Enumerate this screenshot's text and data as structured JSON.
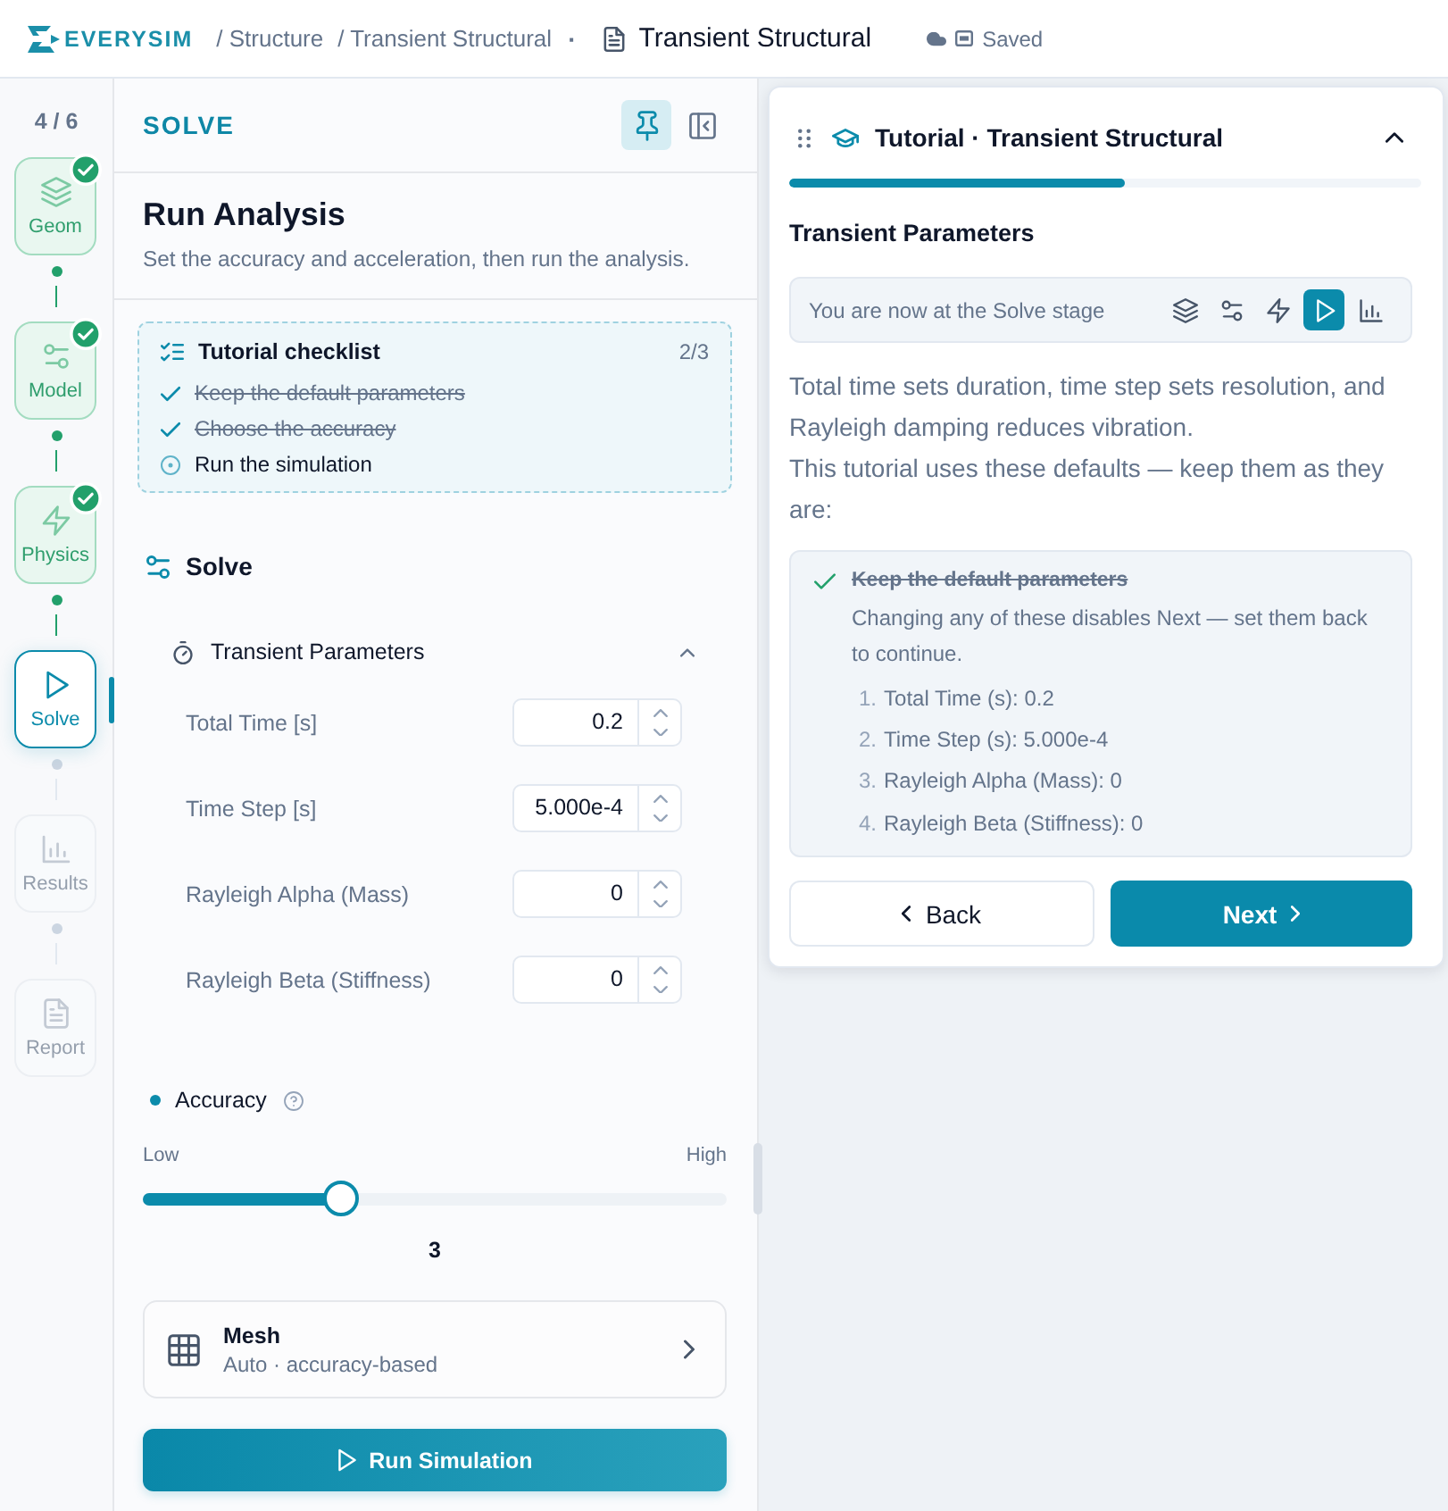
{
  "topbar": {
    "logo": "EVERYSIM",
    "breadcrumbs": [
      "/ Structure",
      "/ Transient Structural"
    ],
    "separator": "·",
    "document_title": "Transient Structural",
    "save_status": "Saved"
  },
  "stepper": {
    "progress": "4 / 6",
    "steps": [
      {
        "label": "Geom",
        "kind": "layers",
        "completed": true,
        "selected": false,
        "disabled": false
      },
      {
        "label": "Model",
        "kind": "sliders",
        "completed": true,
        "selected": false,
        "disabled": false
      },
      {
        "label": "Physics",
        "kind": "bolt",
        "completed": true,
        "selected": false,
        "disabled": false
      },
      {
        "label": "Solve",
        "kind": "play",
        "completed": false,
        "selected": true,
        "disabled": false
      },
      {
        "label": "Results",
        "kind": "chart",
        "completed": false,
        "selected": false,
        "disabled": true
      },
      {
        "label": "Report",
        "kind": "document",
        "completed": false,
        "selected": false,
        "disabled": true
      }
    ]
  },
  "panel": {
    "title": "SOLVE",
    "pinned": true,
    "heading": "Run Analysis",
    "subtitle": "Set the accuracy and acceleration, then run the analysis.",
    "checklist": {
      "title": "Tutorial checklist",
      "count": "2/3",
      "items": [
        {
          "text": "Keep the default parameters",
          "checked": true
        },
        {
          "text": "Choose the accuracy",
          "checked": true
        },
        {
          "text": "Run the simulation",
          "checked": false
        }
      ]
    },
    "section_title": "Solve",
    "group": {
      "title": "Transient Parameters",
      "expanded": true,
      "params": [
        {
          "label": "Total Time [s]",
          "value": "0.2"
        },
        {
          "label": "Time Step [s]",
          "value": "5.000e-4"
        },
        {
          "label": "Rayleigh Alpha (Mass)",
          "value": "0"
        },
        {
          "label": "Rayleigh Beta (Stiffness)",
          "value": "0"
        }
      ]
    },
    "accuracy": {
      "label": "Accuracy",
      "min_label": "Low",
      "max_label": "High",
      "level": 0.34,
      "value": "3"
    },
    "mesh": {
      "title": "Mesh",
      "subtitle": "Auto · accuracy-based"
    },
    "run_button": "Run Simulation"
  },
  "tutorial": {
    "title": "Tutorial · Transient Structural",
    "expanded": true,
    "level": 0.53,
    "step_title": "Transient Parameters",
    "stage_text": "You are now at the Solve stage",
    "stages": [
      {
        "kind": "layers",
        "selected": false
      },
      {
        "kind": "sliders",
        "selected": false
      },
      {
        "kind": "bolt",
        "selected": false
      },
      {
        "kind": "play",
        "selected": true
      },
      {
        "kind": "chart",
        "selected": false
      }
    ],
    "paragraphs": [
      "Total time sets duration, time step sets resolution, and Rayleigh damping reduces vibration.",
      "This tutorial uses these defaults — keep them as they are:"
    ],
    "task": {
      "title": "Keep the default parameters",
      "checked": true,
      "description": "Changing any of these disables Next — set them back to continue.",
      "defaults": [
        {
          "marker": "1.",
          "text": "Total Time (s): 0.2"
        },
        {
          "marker": "2.",
          "text": "Time Step (s): 5.000e-4"
        },
        {
          "marker": "3.",
          "text": "Rayleigh Alpha (Mass): 0"
        },
        {
          "marker": "4.",
          "text": "Rayleigh Beta (Stiffness): 0"
        }
      ]
    },
    "back_button": "Back",
    "next_button": "Next"
  }
}
